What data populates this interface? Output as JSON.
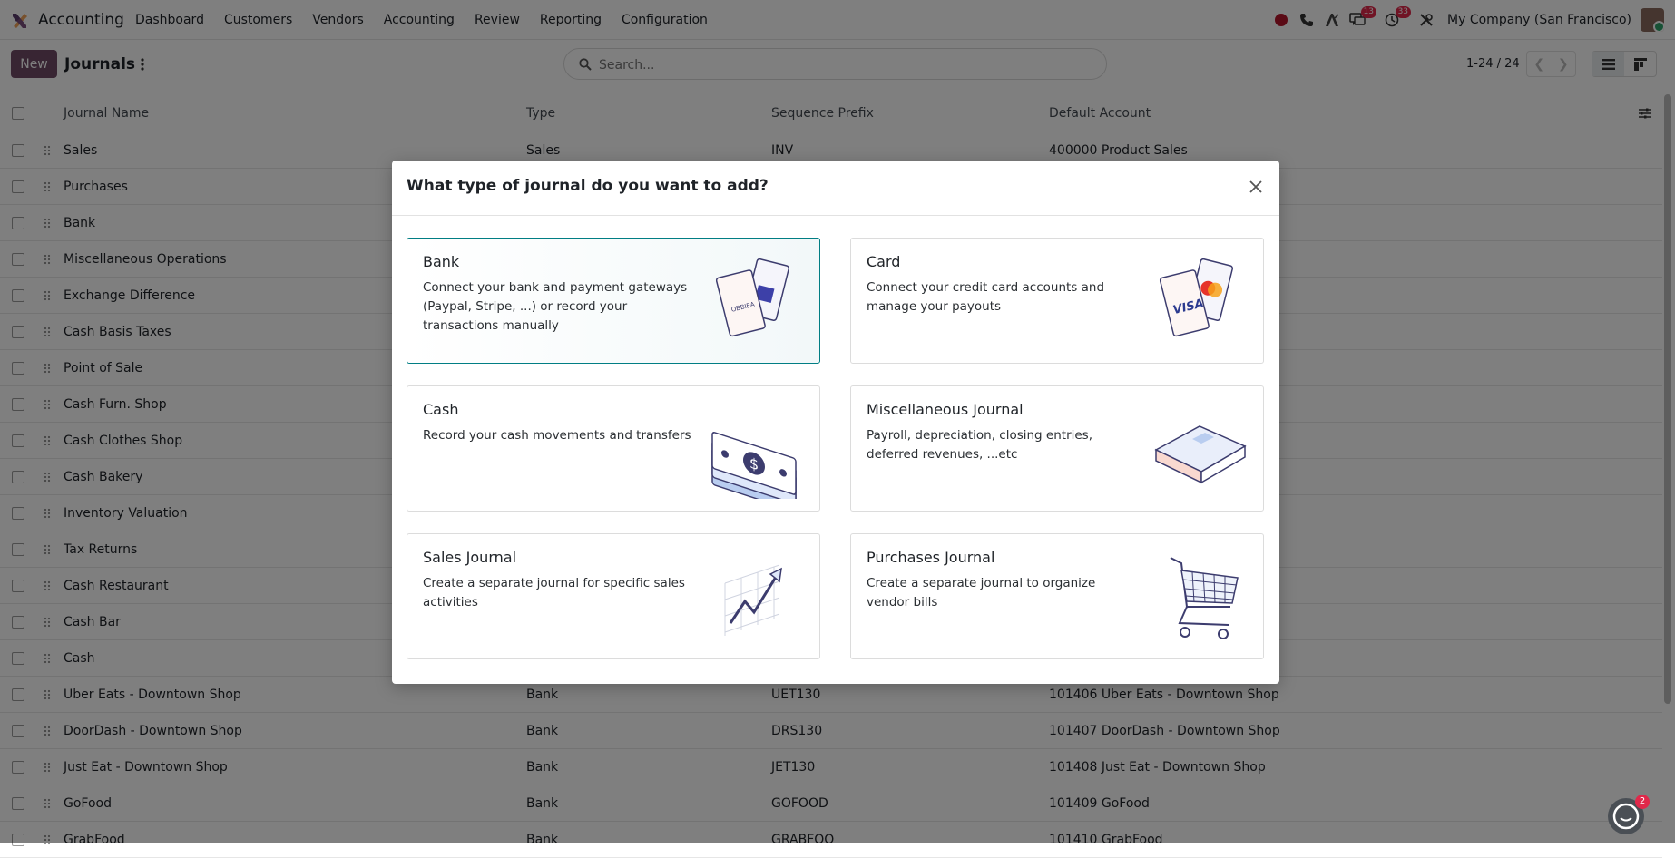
{
  "navbar": {
    "app_name": "Accounting",
    "menu": [
      "Dashboard",
      "Customers",
      "Vendors",
      "Accounting",
      "Review",
      "Reporting",
      "Configuration"
    ],
    "messages_badge": "13",
    "activities_badge": "33",
    "company": "My Company (San Francisco)"
  },
  "control": {
    "new_label": "New",
    "title": "Journals",
    "search_placeholder": "Search...",
    "pager": "1-24 / 24"
  },
  "list": {
    "headers": [
      "Journal Name",
      "Type",
      "Sequence Prefix",
      "Default Account"
    ],
    "rows": [
      [
        "Sales",
        "Sales",
        "INV",
        "400000 Product Sales"
      ],
      [
        "Purchases",
        "",
        "",
        ""
      ],
      [
        "Bank",
        "",
        "",
        ""
      ],
      [
        "Miscellaneous Operations",
        "",
        "",
        ""
      ],
      [
        "Exchange Difference",
        "",
        "",
        ""
      ],
      [
        "Cash Basis Taxes",
        "",
        "",
        ""
      ],
      [
        "Point of Sale",
        "",
        "",
        ""
      ],
      [
        "Cash Furn. Shop",
        "",
        "",
        ""
      ],
      [
        "Cash Clothes Shop",
        "",
        "",
        ""
      ],
      [
        "Cash Bakery",
        "",
        "",
        ""
      ],
      [
        "Inventory Valuation",
        "",
        "",
        ""
      ],
      [
        "Tax Returns",
        "",
        "",
        ""
      ],
      [
        "Cash Restaurant",
        "",
        "",
        ""
      ],
      [
        "Cash Bar",
        "",
        "",
        ""
      ],
      [
        "Cash",
        "",
        "",
        ""
      ],
      [
        "Uber Eats - Downtown Shop",
        "Bank",
        "UET130",
        "101406 Uber Eats - Downtown Shop"
      ],
      [
        "DoorDash - Downtown Shop",
        "Bank",
        "DRS130",
        "101407 DoorDash - Downtown Shop"
      ],
      [
        "Just Eat - Downtown Shop",
        "Bank",
        "JET130",
        "101408 Just Eat - Downtown Shop"
      ],
      [
        "GoFood",
        "Bank",
        "GOFOOD",
        "101409 GoFood"
      ],
      [
        "GrabFood",
        "Bank",
        "GRABFOO",
        "101410 GrabFood"
      ]
    ]
  },
  "modal": {
    "title": "What type of journal do you want to add?",
    "cards": [
      {
        "title": "Bank",
        "desc": "Connect your bank and payment gateways (Paypal, Stripe, ...) or record your transactions manually",
        "icon": "bank-cards-illustration"
      },
      {
        "title": "Card",
        "desc": "Connect your credit card accounts and manage your payouts",
        "icon": "credit-cards-illustration"
      },
      {
        "title": "Cash",
        "desc": "Record your cash movements and transfers",
        "icon": "cash-illustration"
      },
      {
        "title": "Miscellaneous Journal",
        "desc": "Payroll, depreciation, closing entries, deferred revenues, ...etc",
        "icon": "book-illustration"
      },
      {
        "title": "Sales Journal",
        "desc": "Create a separate journal for specific sales activities",
        "icon": "chart-illustration"
      },
      {
        "title": "Purchases Journal",
        "desc": "Create a separate journal to organize vendor bills",
        "icon": "cart-illustration"
      }
    ]
  },
  "chat": {
    "badge": "2"
  },
  "colors": {
    "brand": "#714b67",
    "accent": "#017e84",
    "badge": "#e0284a"
  }
}
